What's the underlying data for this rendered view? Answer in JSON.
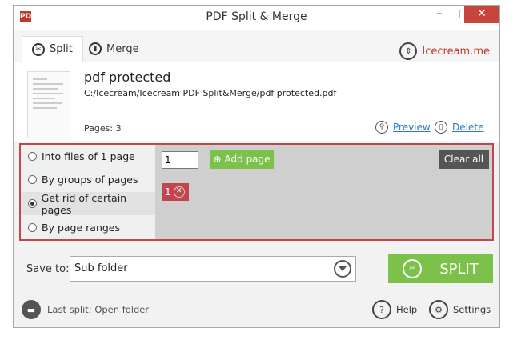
{
  "window": {
    "title": "PDF Split & Merge",
    "app_icon": "PDF",
    "minimize": "–",
    "maximize": "□",
    "close": "✕"
  },
  "tabs": {
    "split_label": "Split",
    "merge_label": "Merge",
    "brand": "Icecream.me"
  },
  "file": {
    "name": "pdf protected",
    "path": "C:/Icecream/Icecream PDF Split&Merge/pdf protected.pdf",
    "pages": "Pages: 3",
    "preview_label": "Preview",
    "delete_label": "Delete"
  },
  "options": {
    "items": [
      "Into files of 1 page",
      "By groups of pages",
      "Get rid of certain pages",
      "By page ranges"
    ],
    "selected_index": 2,
    "page_input_value": "1",
    "add_page_label": "Add page",
    "clear_all_label": "Clear all",
    "tags": [
      "1"
    ]
  },
  "save": {
    "label": "Save to:",
    "value": "Sub folder",
    "split_label": "SPLIT"
  },
  "footer": {
    "last_split": "Last split: Open folder",
    "help": "Help",
    "settings": "Settings"
  },
  "colors": {
    "accent_green": "#7cc24a",
    "accent_red": "#c0474e",
    "link_blue": "#2e7bbf"
  }
}
